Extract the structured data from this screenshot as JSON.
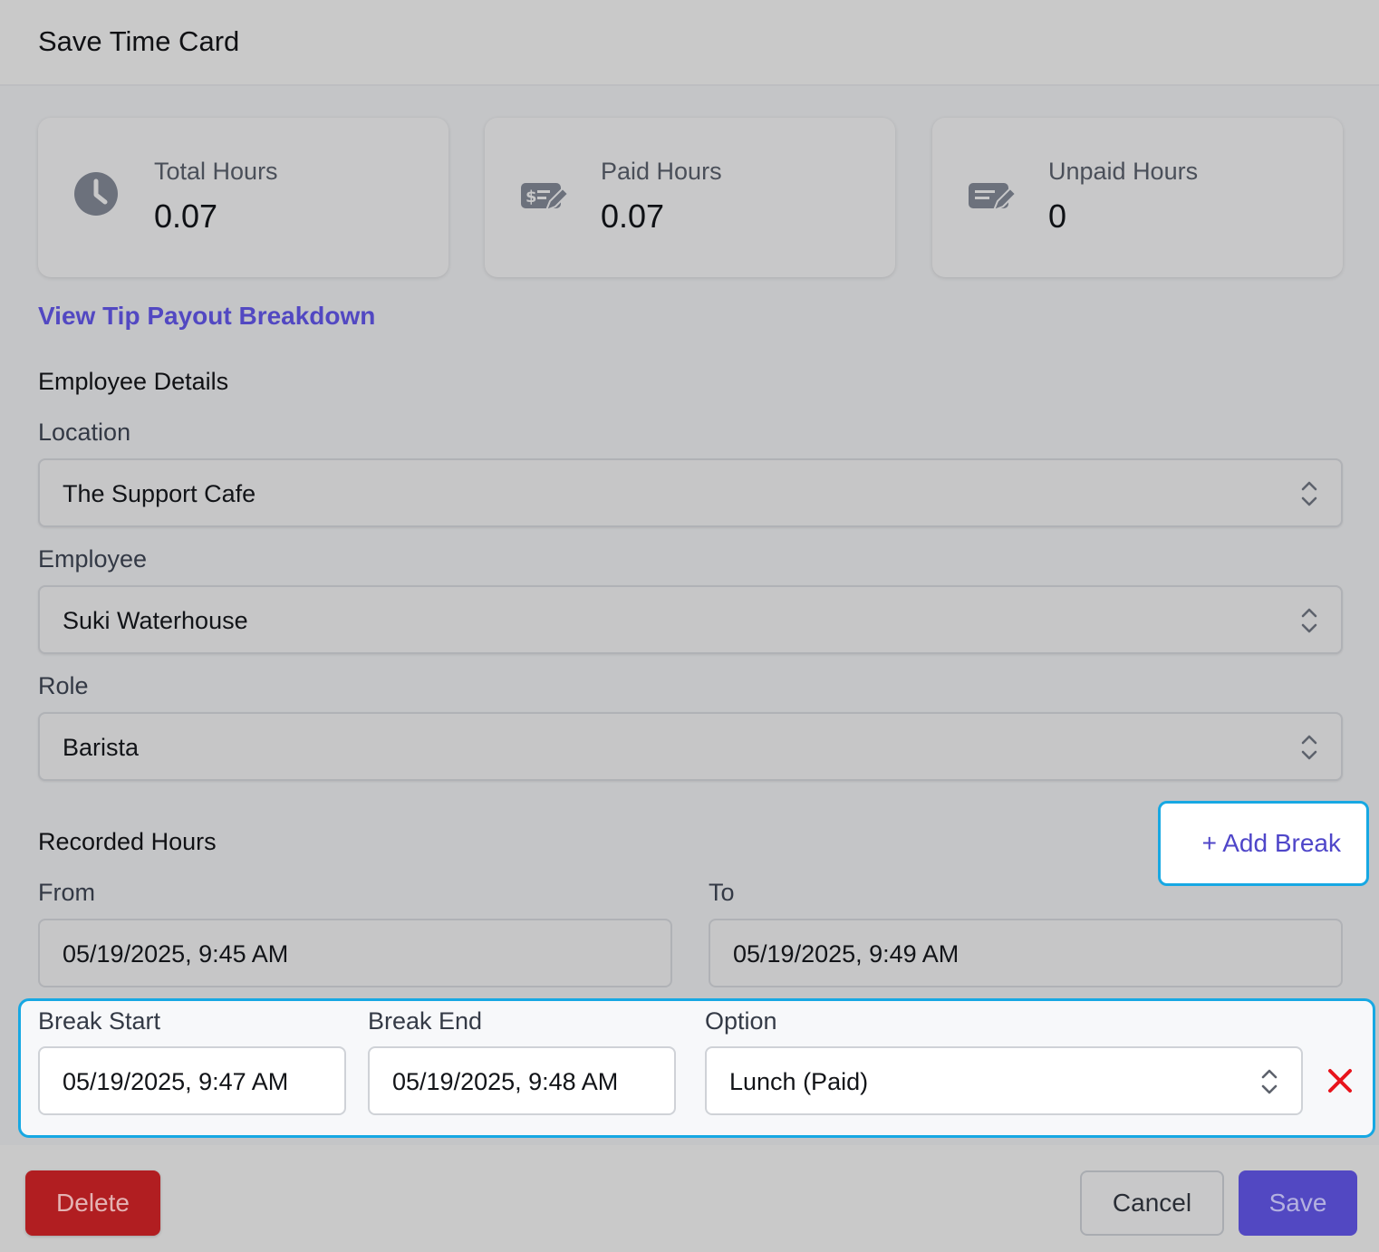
{
  "header": {
    "title": "Save Time Card"
  },
  "stats": [
    {
      "label": "Total Hours",
      "value": "0.07",
      "icon": "clock-icon"
    },
    {
      "label": "Paid Hours",
      "value": "0.07",
      "icon": "dollar-note-edit-icon"
    },
    {
      "label": "Unpaid Hours",
      "value": "0",
      "icon": "note-edit-icon"
    }
  ],
  "tip_link": "View Tip Payout Breakdown",
  "employee_details": {
    "title": "Employee Details",
    "location": {
      "label": "Location",
      "value": "The Support Cafe"
    },
    "employee": {
      "label": "Employee",
      "value": "Suki Waterhouse"
    },
    "role": {
      "label": "Role",
      "value": "Barista"
    }
  },
  "recorded_hours": {
    "title": "Recorded Hours",
    "add_break_label": "+ Add Break",
    "from": {
      "label": "From",
      "value": "05/19/2025, 9:45 AM"
    },
    "to": {
      "label": "To",
      "value": "05/19/2025, 9:49 AM"
    }
  },
  "break": {
    "start": {
      "label": "Break Start",
      "value": "05/19/2025, 9:47 AM"
    },
    "end": {
      "label": "Break End",
      "value": "05/19/2025, 9:48 AM"
    },
    "option": {
      "label": "Option",
      "value": "Lunch (Paid)"
    },
    "remove_icon": "close-icon"
  },
  "footer": {
    "delete_label": "Delete",
    "cancel_label": "Cancel",
    "save_label": "Save"
  },
  "colors": {
    "accent": "#5248c2",
    "focus_ring": "#17a8e3",
    "danger": "#b11e21",
    "remove_x": "#e8141c"
  }
}
